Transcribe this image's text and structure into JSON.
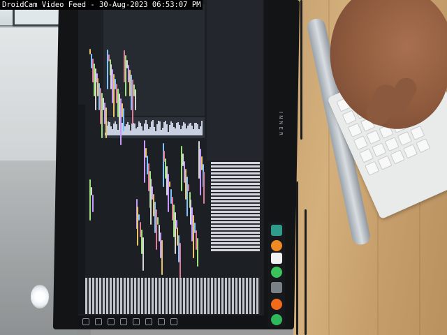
{
  "overlay": {
    "title": "DroidCam Video Feed - 30-Aug-2023 06:53:07 PM"
  },
  "monitor": {
    "brand": "INNER"
  },
  "colors": {
    "desk": "#c9a473",
    "screen": "#1c1f24",
    "bezel": "#121416"
  }
}
